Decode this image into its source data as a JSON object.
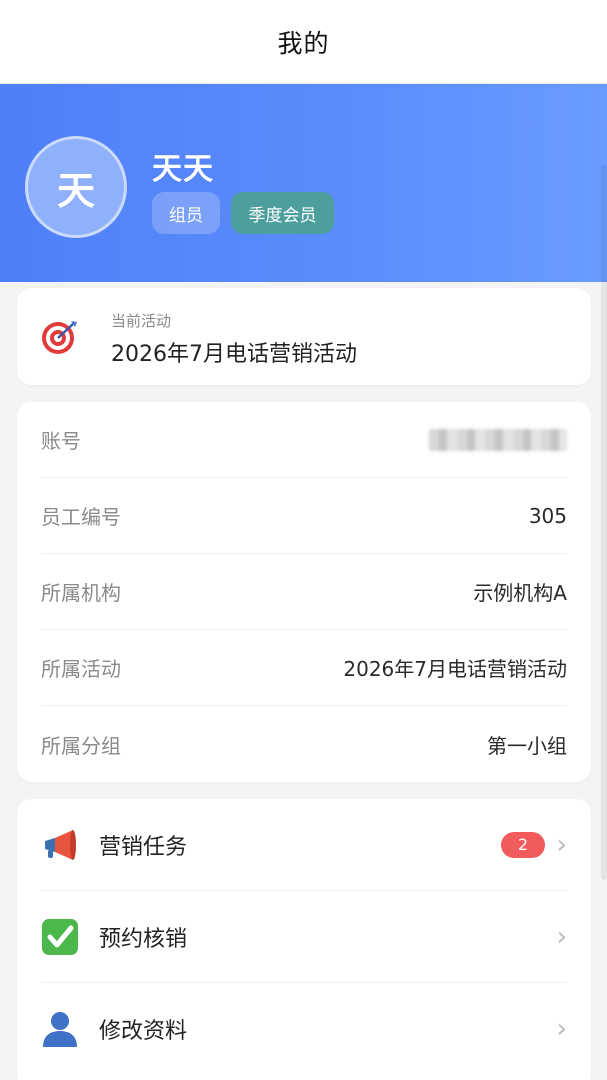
{
  "nav": {
    "title": "我的"
  },
  "profile": {
    "avatar_char": "天",
    "name": "天天",
    "tags": [
      "组员",
      "季度会员"
    ]
  },
  "current_activity": {
    "label": "当前活动",
    "value": "2026年7月电话营销活动"
  },
  "info": [
    {
      "label": "账号",
      "value": ""
    },
    {
      "label": "员工编号",
      "value": "305"
    },
    {
      "label": "所属机构",
      "value": "示例机构A"
    },
    {
      "label": "所属活动",
      "value": "2026年7月电话营销活动"
    },
    {
      "label": "所属分组",
      "value": "第一小组"
    }
  ],
  "menu": [
    {
      "label": "营销任务",
      "icon": "megaphone-icon",
      "badge": "2"
    },
    {
      "label": "预约核销",
      "icon": "check-mark-icon"
    },
    {
      "label": "修改资料",
      "icon": "user-icon"
    }
  ],
  "colors": {
    "header_gradient_start": "#4f7ff7",
    "header_gradient_end": "#6a9bff",
    "member_tag": "#4d9f9e",
    "badge": "#f15b5b"
  }
}
